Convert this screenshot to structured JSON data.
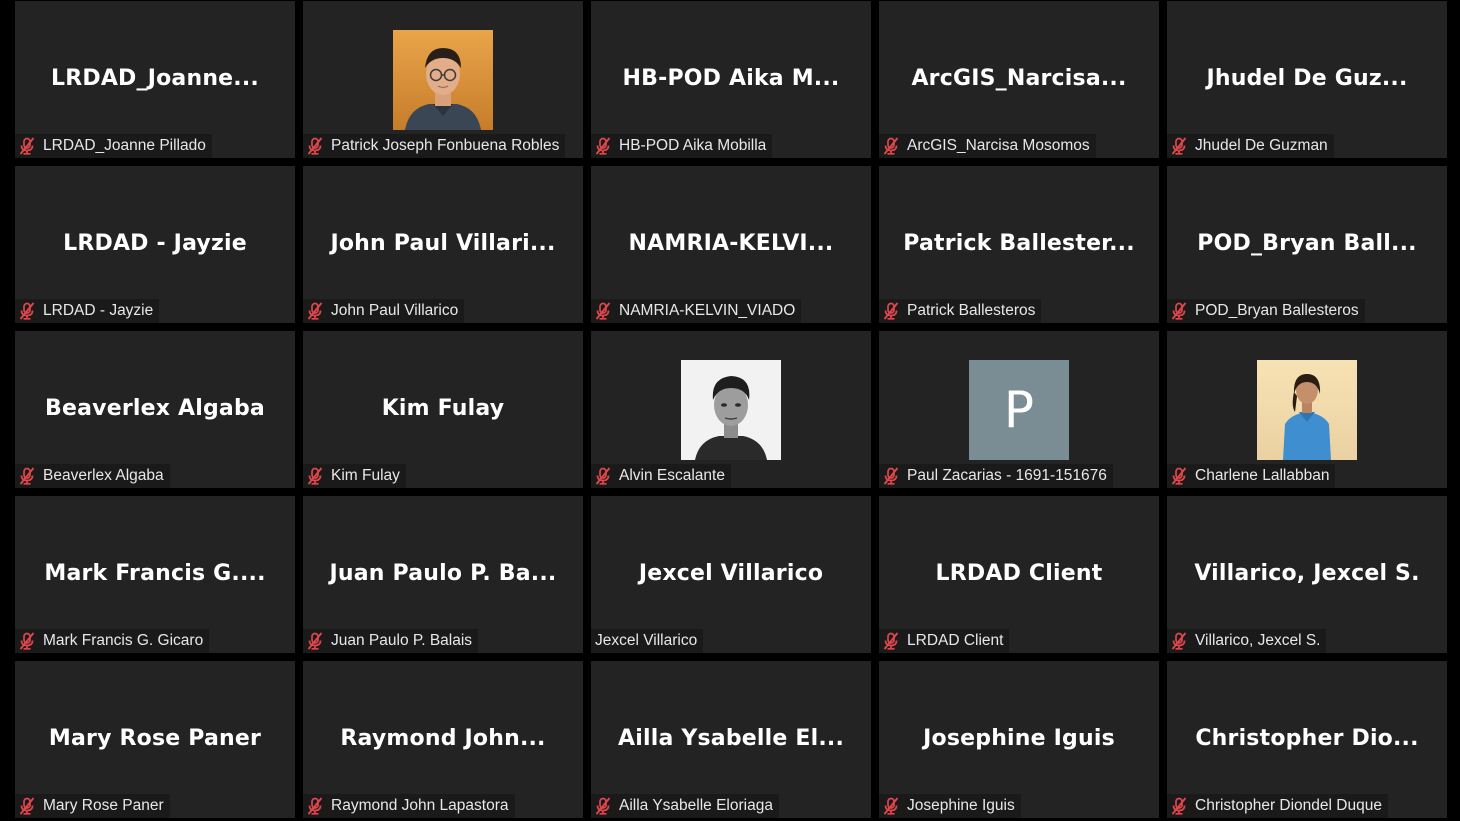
{
  "colors": {
    "background": "#000000",
    "tile": "#232323",
    "label_bg": "#1a1a1a",
    "mute_red": "#e0474c",
    "avatar_letter_bg": "#7a8c94"
  },
  "participants": [
    {
      "display": "LRDAD_Joanne...",
      "label": "LRDAD_Joanne Pillado",
      "muted": true,
      "avatar": null
    },
    {
      "display": "",
      "label": "Patrick Joseph Fonbuena Robles",
      "muted": true,
      "avatar": "photo-young-man-glasses"
    },
    {
      "display": "HB-POD  Aika  M...",
      "label": "HB-POD Aika Mobilla",
      "muted": true,
      "avatar": null
    },
    {
      "display": "ArcGIS_Narcisa...",
      "label": "ArcGIS_Narcisa Mosomos",
      "muted": true,
      "avatar": null
    },
    {
      "display": "Jhudel  De  Guz...",
      "label": "Jhudel De Guzman",
      "muted": true,
      "avatar": null
    },
    {
      "display": "LRDAD - Jayzie",
      "label": "LRDAD - Jayzie",
      "muted": true,
      "avatar": null
    },
    {
      "display": "John  Paul  Villari...",
      "label": "John Paul Villarico",
      "muted": true,
      "avatar": null
    },
    {
      "display": "NAMRIA-KELVI...",
      "label": "NAMRIA-KELVIN_VIADO",
      "muted": true,
      "avatar": null
    },
    {
      "display": "Patrick  Ballester...",
      "label": "Patrick Ballesteros",
      "muted": true,
      "avatar": null
    },
    {
      "display": "POD_Bryan  Ball...",
      "label": "POD_Bryan Ballesteros",
      "muted": true,
      "avatar": null
    },
    {
      "display": "Beaverlex Algaba",
      "label": "Beaverlex Algaba",
      "muted": true,
      "avatar": null
    },
    {
      "display": "Kim Fulay",
      "label": "Kim Fulay",
      "muted": true,
      "avatar": null
    },
    {
      "display": "",
      "label": "Alvin Escalante",
      "muted": true,
      "avatar": "photo-id-grayscale"
    },
    {
      "display": "",
      "label": "Paul Zacarias - 1691-151676",
      "muted": true,
      "avatar": "letter",
      "avatar_letter": "P"
    },
    {
      "display": "",
      "label": "Charlene Lallabban",
      "muted": true,
      "avatar": "photo-woman-blue-shirt"
    },
    {
      "display": "Mark  Francis  G....",
      "label": "Mark Francis G. Gicaro",
      "muted": true,
      "avatar": null
    },
    {
      "display": "Juan  Paulo  P.  Ba...",
      "label": "Juan Paulo P. Balais",
      "muted": true,
      "avatar": null
    },
    {
      "display": "Jexcel Villarico",
      "label": "Jexcel Villarico",
      "muted": false,
      "avatar": null
    },
    {
      "display": "LRDAD Client",
      "label": "LRDAD Client",
      "muted": true,
      "avatar": null
    },
    {
      "display": "Villarico, Jexcel S.",
      "label": "Villarico, Jexcel S.",
      "muted": true,
      "avatar": null
    },
    {
      "display": "Mary Rose Paner",
      "label": "Mary Rose Paner",
      "muted": true,
      "avatar": null
    },
    {
      "display": "Raymond  John...",
      "label": "Raymond John Lapastora",
      "muted": true,
      "avatar": null
    },
    {
      "display": "Ailla  Ysabelle  El...",
      "label": "Ailla Ysabelle Eloriaga",
      "muted": true,
      "avatar": null
    },
    {
      "display": "Josephine Iguis",
      "label": "Josephine Iguis",
      "muted": true,
      "avatar": null
    },
    {
      "display": "Christopher  Dio...",
      "label": "Christopher Diondel Duque",
      "muted": true,
      "avatar": null
    }
  ]
}
